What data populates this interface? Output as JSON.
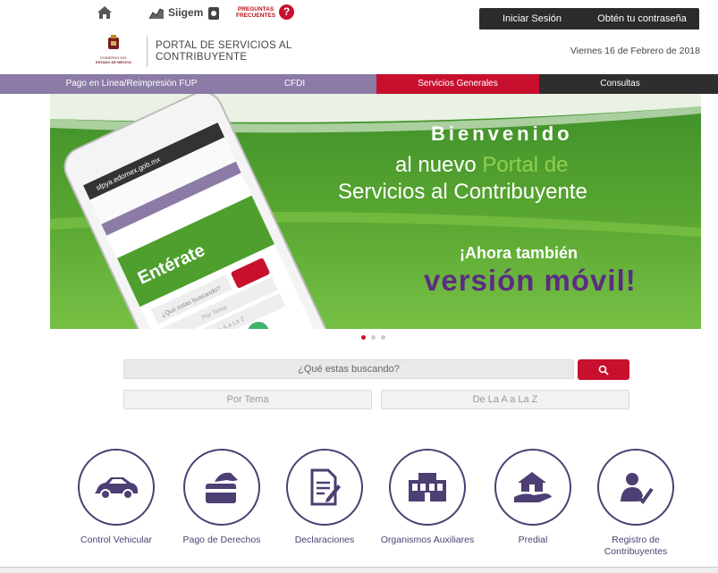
{
  "topbar": {
    "siigem_label": "Siigem",
    "faq_label": "PREGUNTAS FRECUENTES",
    "faq_line1": "PREGUNTAS",
    "faq_line2": "FRECUENTES",
    "login": "Iniciar Sesión",
    "get_password": "Obtén tu contraseña"
  },
  "header": {
    "logo_text_1": "GOBIERNO DEL",
    "logo_text_2": "ESTADO DE MÉXICO",
    "title_line1": "PORTAL DE SERVICIOS AL",
    "title_line2": "CONTRIBUYENTE",
    "date": "Viernes 16 de Febrero de 2018"
  },
  "nav": [
    "Pago en Línea/Reimpresión FUP",
    "CFDI",
    "Servicios Generales",
    "Consultas"
  ],
  "banner": {
    "welcome": "Bienvenido",
    "line2_a": "al nuevo",
    "line2_b": "Portal de",
    "line3": "Servicios al Contribuyente",
    "also": "¡Ahora también",
    "mobile": "versión móvil!",
    "phone_search": "¿Qué estas buscando?",
    "phone_tema": "Por Tema",
    "phone_az": "De La A a La Z",
    "phone_promo": "Entérate",
    "phone_url": "sfpya.edomex.gob.mx"
  },
  "colors": {
    "accent_red": "#c8102e",
    "nav_purple": "#8b7ba6",
    "dark": "#2e2e2e",
    "service_purple": "#4d3f73",
    "banner_green": "#5aa832"
  },
  "carousel": {
    "slides": 3,
    "active": 1
  },
  "search": {
    "placeholder": "¿Qué estas buscando?",
    "by_topic": "Por Tema",
    "a_to_z": "De La A a La Z"
  },
  "services": [
    {
      "label": "Control Vehicular",
      "icon": "car-icon"
    },
    {
      "label": "Pago de Derechos",
      "icon": "payment-card-icon"
    },
    {
      "label": "Declaraciones",
      "icon": "document-edit-icon"
    },
    {
      "label": "Organismos Auxiliares",
      "icon": "building-icon"
    },
    {
      "label": "Predial",
      "icon": "house-hand-icon"
    },
    {
      "label": "Registro de Contribuyentes",
      "icon": "user-check-icon"
    }
  ]
}
